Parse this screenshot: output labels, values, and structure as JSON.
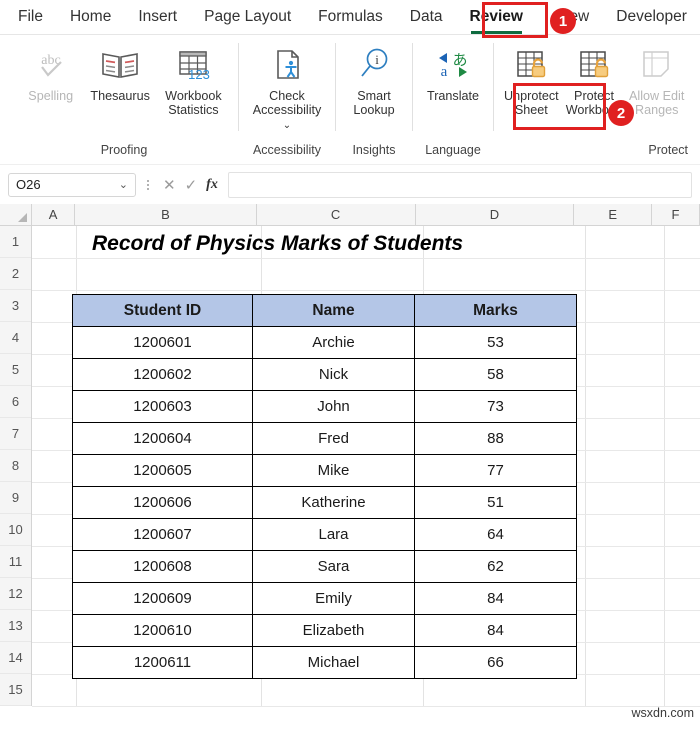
{
  "ribbon": {
    "tabs": [
      {
        "label": "File",
        "active": false
      },
      {
        "label": "Home",
        "active": false
      },
      {
        "label": "Insert",
        "active": false
      },
      {
        "label": "Page Layout",
        "active": false
      },
      {
        "label": "Formulas",
        "active": false
      },
      {
        "label": "Data",
        "active": false
      },
      {
        "label": "Review",
        "active": true
      },
      {
        "label": "View",
        "active": false
      },
      {
        "label": "Developer",
        "active": false
      }
    ],
    "groups": [
      {
        "label": "Proofing",
        "buttons": [
          {
            "label": "Spelling",
            "icon": "spelling-icon",
            "disabled": true
          },
          {
            "label": "Thesaurus",
            "icon": "thesaurus-icon",
            "disabled": false
          },
          {
            "label": "Workbook Statistics",
            "icon": "workbook-statistics-icon",
            "disabled": false
          }
        ]
      },
      {
        "label": "Accessibility",
        "buttons": [
          {
            "label": "Check Accessibility",
            "icon": "check-accessibility-icon",
            "disabled": false
          }
        ]
      },
      {
        "label": "Insights",
        "buttons": [
          {
            "label": "Smart Lookup",
            "icon": "smart-lookup-icon",
            "disabled": false
          }
        ]
      },
      {
        "label": "Language",
        "buttons": [
          {
            "label": "Translate",
            "icon": "translate-icon",
            "disabled": false
          }
        ]
      },
      {
        "label": "Protect",
        "buttons": [
          {
            "label": "Unprotect Sheet",
            "icon": "unprotect-sheet-icon",
            "disabled": false
          },
          {
            "label": "Protect Workbook",
            "icon": "protect-workbook-icon",
            "disabled": false
          },
          {
            "label": "Allow Edit Ranges",
            "icon": "allow-edit-ranges-icon",
            "disabled": true
          }
        ]
      }
    ]
  },
  "formula_bar": {
    "name_box_value": "O26",
    "formula_value": "",
    "cancel_glyph": "✕",
    "enter_glyph": "✓",
    "fx_label": "fx"
  },
  "grid": {
    "columns": [
      "A",
      "B",
      "C",
      "D",
      "E",
      "F"
    ],
    "rows": [
      "1",
      "2",
      "3",
      "4",
      "5",
      "6",
      "7",
      "8",
      "9",
      "10",
      "11",
      "12",
      "13",
      "14",
      "15"
    ]
  },
  "sheet": {
    "title": "Record of Physics Marks of Students",
    "header_fill": "#b4c6e7",
    "table": {
      "headers": [
        "Student ID",
        "Name",
        "Marks"
      ],
      "rows": [
        [
          "1200601",
          "Archie",
          "53"
        ],
        [
          "1200602",
          "Nick",
          "58"
        ],
        [
          "1200603",
          "John",
          "73"
        ],
        [
          "1200604",
          "Fred",
          "88"
        ],
        [
          "1200605",
          "Mike",
          "77"
        ],
        [
          "1200606",
          "Katherine",
          "51"
        ],
        [
          "1200607",
          "Lara",
          "64"
        ],
        [
          "1200608",
          "Sara",
          "62"
        ],
        [
          "1200609",
          "Emily",
          "84"
        ],
        [
          "1200610",
          "Elizabeth",
          "84"
        ],
        [
          "1200611",
          "Michael",
          "66"
        ]
      ]
    }
  },
  "annotations": {
    "accent_color": "#e02020",
    "badges": [
      {
        "number": "1"
      },
      {
        "number": "2"
      }
    ]
  },
  "watermark": {
    "text": "wsxdn.com"
  }
}
